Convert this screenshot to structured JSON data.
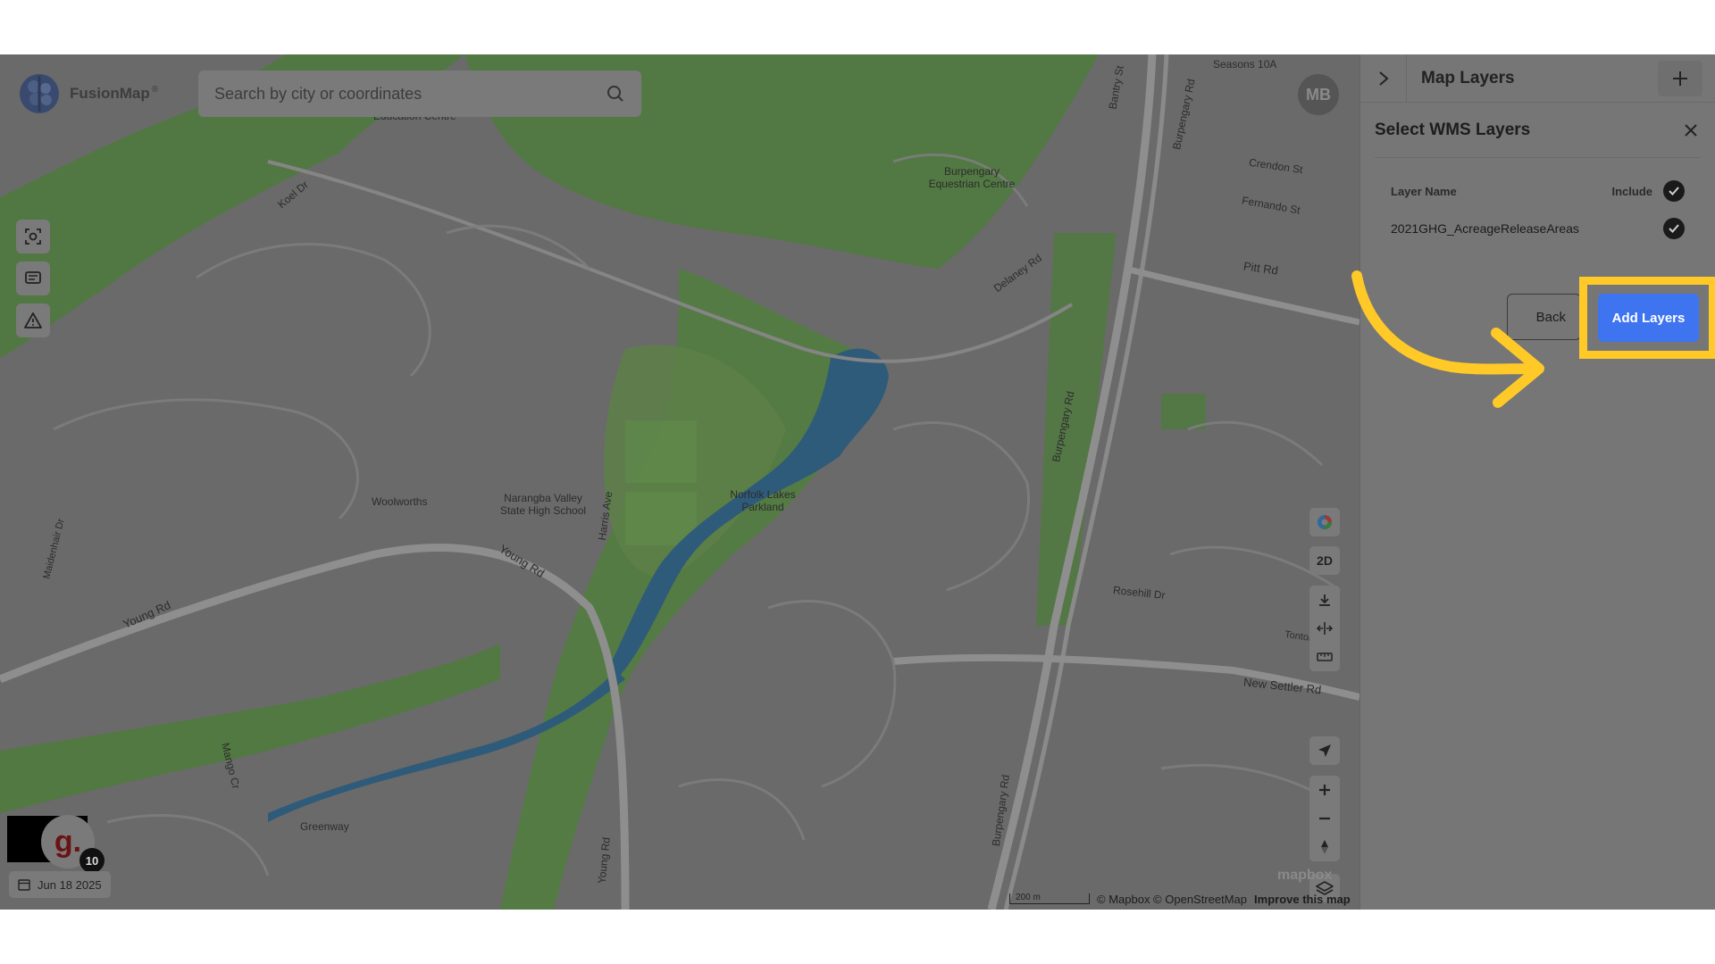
{
  "app": {
    "logo_text": "FusionMap",
    "logo_trademark": "®",
    "avatar_initials": "MB"
  },
  "search": {
    "placeholder": "Search by city or coordinates",
    "value": ""
  },
  "left_tools": [
    {
      "icon": "screenshot-focus-icon"
    },
    {
      "icon": "message-icon"
    },
    {
      "icon": "warning-icon"
    }
  ],
  "map_controls": {
    "color_wheel_icon": "color-wheel-icon",
    "view_mode_label": "2D",
    "download_icon": "download-icon",
    "split_icon": "split-view-icon",
    "ruler_icon": "ruler-icon",
    "locate_icon": "locate-icon",
    "zoom_in_icon": "plus-icon",
    "zoom_out_icon": "minus-icon",
    "compass_icon": "compass-icon",
    "layers_icon": "layers-icon"
  },
  "map_labels": {
    "education_centre": "Education Centre",
    "burpengary_equestrian": "Burpengary\nEquestrian Centre",
    "seasons": "Seasons 10A",
    "bantry_st": "Bantry St",
    "burpengary_rd_top": "Burpengary Rd",
    "crendon_st": "Crendon St",
    "fernando_st": "Fernando St",
    "pitt_rd": "Pitt Rd",
    "delaney_rd": "Delaney Rd",
    "koel_dr": "Koel Dr",
    "woolworths": "Woolworths",
    "narangba_valley": "Narangba Valley\nState High School",
    "harris_ave": "Harris Ave",
    "norfolk_lakes": "Norfolk Lakes\nParkland",
    "young_rd_1": "Young Rd",
    "young_rd_2": "Young Rd",
    "young_rd_3": "Young Rd",
    "burpengary_rd_mid": "Burpengary Rd",
    "burpengary_rd_bot": "Burpengary Rd",
    "rosehill_dr": "Rosehill Dr",
    "tontonan": "Tontonan St",
    "new_settler_rd": "New Settler Rd",
    "mango_cr": "Mango Cr",
    "greenway": "Greenway",
    "meadowlark_dr": "Maidenhair Dr"
  },
  "date_chip": {
    "label": "Jun 18 2025",
    "icon": "calendar-icon"
  },
  "badge": {
    "letter": "g.",
    "count": "10"
  },
  "attribution": {
    "scale_label": "200 m",
    "text": "© Mapbox © OpenStreetMap",
    "improve": "Improve this map",
    "mapbox_logo": "mapbox"
  },
  "panel": {
    "title": "Map Layers",
    "collapse_icon": "chevron-right-icon",
    "add_icon": "plus-icon",
    "sub_title": "Select WMS Layers",
    "close_icon": "close-icon",
    "columns": {
      "layer_name": "Layer Name",
      "include": "Include"
    },
    "rows": [
      {
        "name": "2021GHG_AcreageReleaseAreas",
        "included": true
      }
    ],
    "back_label": "Back",
    "add_layers_label": "Add Layers"
  },
  "colors": {
    "highlight": "#ffc928",
    "primary": "#3e74f0",
    "overlay_dim": "#6e6e6e"
  }
}
